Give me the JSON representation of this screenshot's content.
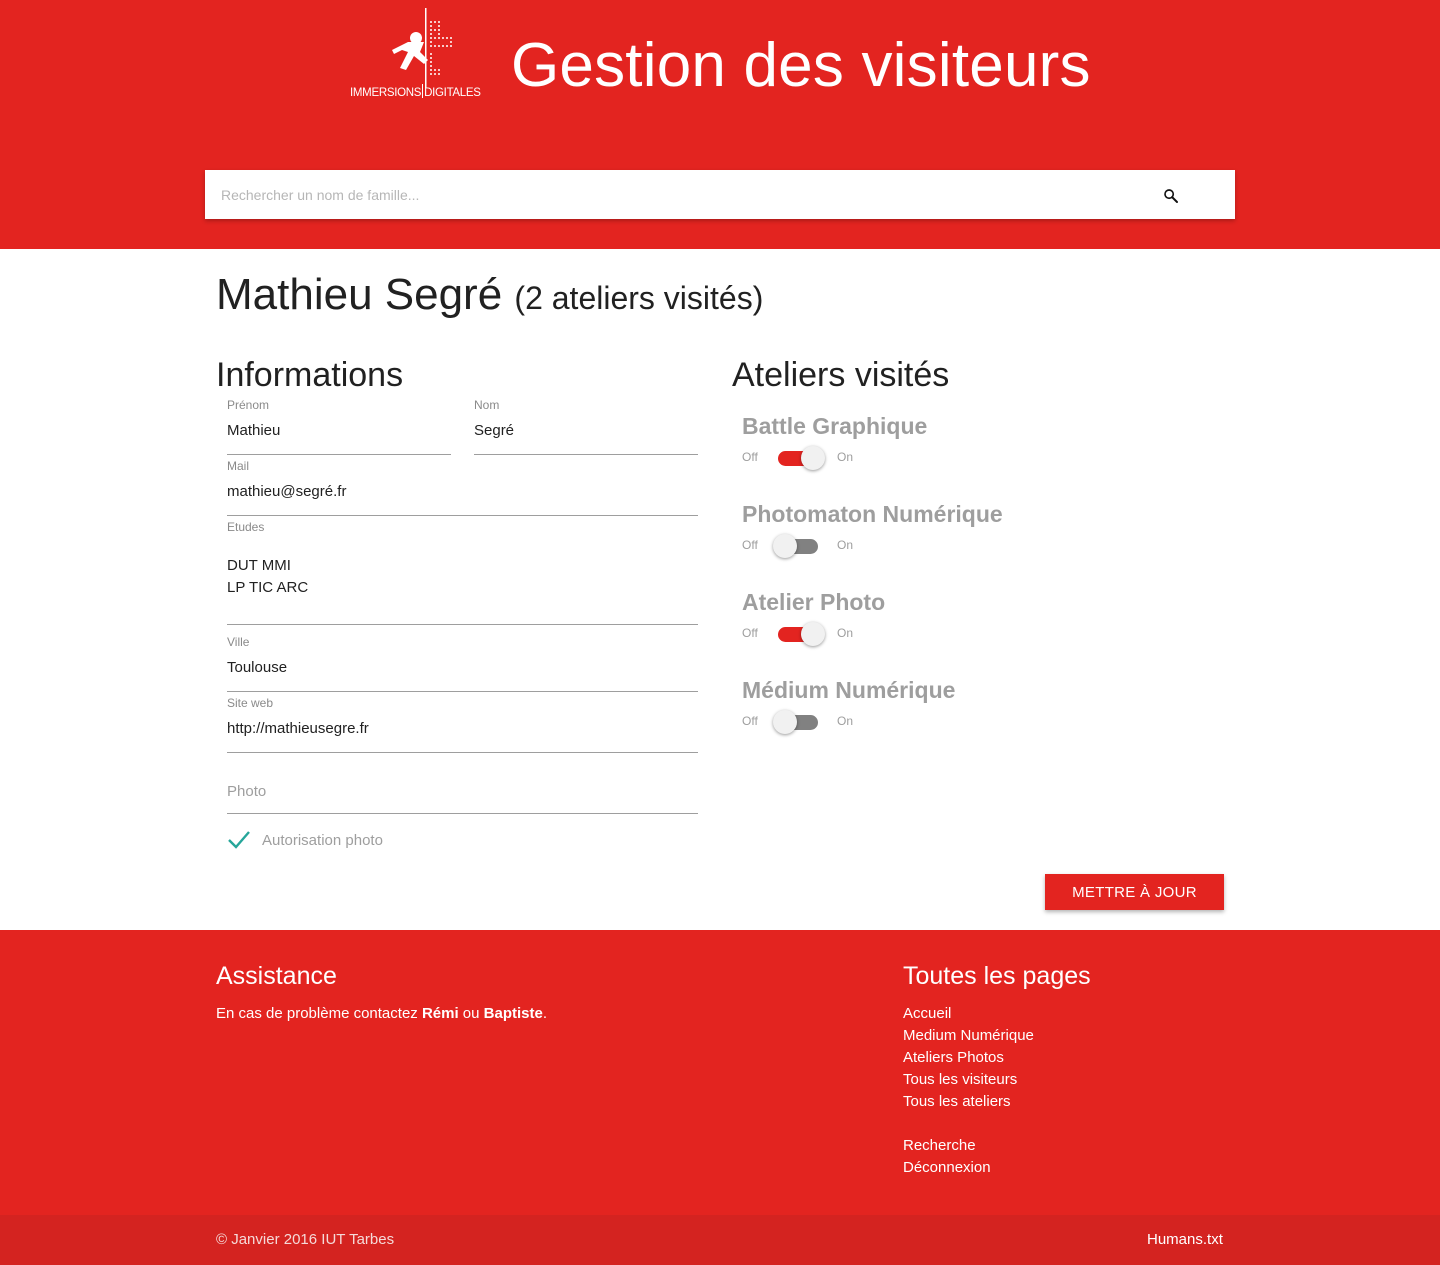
{
  "header": {
    "logo_text_left": "IMMERSIONS",
    "logo_text_right": "DIGITALES",
    "title": "Gestion des visiteurs",
    "search_placeholder": "Rechercher un nom de famille...",
    "search_icon": "search-icon",
    "brand_color": "#e32420"
  },
  "visitor": {
    "name": "Mathieu Segré",
    "workshops_count": "(2 ateliers visités)"
  },
  "informations": {
    "title": "Informations",
    "prenom_label": "Prénom",
    "prenom_value": "Mathieu",
    "nom_label": "Nom",
    "nom_value": "Segré",
    "mail_label": "Mail",
    "mail_value": "mathieu@segré.fr",
    "etudes_label": "Etudes",
    "etudes_line1": "DUT MMI",
    "etudes_line2": "LP TIC ARC",
    "ville_label": "Ville",
    "ville_value": "Toulouse",
    "site_label": "Site web",
    "site_value": "http://mathieusegre.fr",
    "photo_placeholder": "Photo",
    "autorisation_label": "Autorisation photo",
    "autorisation_checked": true
  },
  "ateliers": {
    "title": "Ateliers visités",
    "off_label": "Off",
    "on_label": "On",
    "items": [
      {
        "name": "Battle Graphique",
        "enabled": true
      },
      {
        "name": "Photomaton Numérique",
        "enabled": false
      },
      {
        "name": "Atelier Photo",
        "enabled": true
      },
      {
        "name": "Médium Numérique",
        "enabled": false
      }
    ]
  },
  "update_button": "METTRE À JOUR",
  "footer": {
    "assistance_title": "Assistance",
    "assistance_text_before": "En cas de problème contactez ",
    "contact_1": "Rémi",
    "assistance_text_mid": " ou ",
    "contact_2": "Baptiste",
    "assistance_text_end": ".",
    "pages_title": "Toutes les pages",
    "links": [
      "Accueil",
      "Medium Numérique",
      "Ateliers Photos",
      "Tous les visiteurs",
      "Tous les ateliers",
      "Recherche",
      "Déconnexion"
    ],
    "copyright": "© Janvier 2016 IUT Tarbes",
    "humans": "Humans.txt"
  }
}
